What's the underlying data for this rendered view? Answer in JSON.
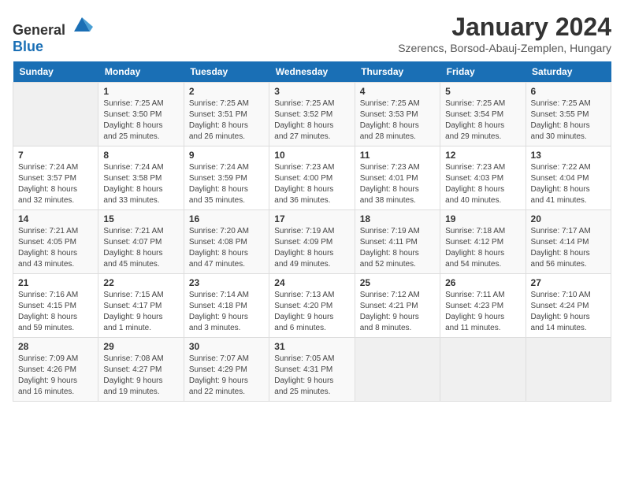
{
  "header": {
    "logo_general": "General",
    "logo_blue": "Blue",
    "month_year": "January 2024",
    "location": "Szerencs, Borsod-Abauj-Zemplen, Hungary"
  },
  "weekdays": [
    "Sunday",
    "Monday",
    "Tuesday",
    "Wednesday",
    "Thursday",
    "Friday",
    "Saturday"
  ],
  "weeks": [
    [
      {
        "day": "",
        "info": ""
      },
      {
        "day": "1",
        "info": "Sunrise: 7:25 AM\nSunset: 3:50 PM\nDaylight: 8 hours\nand 25 minutes."
      },
      {
        "day": "2",
        "info": "Sunrise: 7:25 AM\nSunset: 3:51 PM\nDaylight: 8 hours\nand 26 minutes."
      },
      {
        "day": "3",
        "info": "Sunrise: 7:25 AM\nSunset: 3:52 PM\nDaylight: 8 hours\nand 27 minutes."
      },
      {
        "day": "4",
        "info": "Sunrise: 7:25 AM\nSunset: 3:53 PM\nDaylight: 8 hours\nand 28 minutes."
      },
      {
        "day": "5",
        "info": "Sunrise: 7:25 AM\nSunset: 3:54 PM\nDaylight: 8 hours\nand 29 minutes."
      },
      {
        "day": "6",
        "info": "Sunrise: 7:25 AM\nSunset: 3:55 PM\nDaylight: 8 hours\nand 30 minutes."
      }
    ],
    [
      {
        "day": "7",
        "info": "Sunrise: 7:24 AM\nSunset: 3:57 PM\nDaylight: 8 hours\nand 32 minutes."
      },
      {
        "day": "8",
        "info": "Sunrise: 7:24 AM\nSunset: 3:58 PM\nDaylight: 8 hours\nand 33 minutes."
      },
      {
        "day": "9",
        "info": "Sunrise: 7:24 AM\nSunset: 3:59 PM\nDaylight: 8 hours\nand 35 minutes."
      },
      {
        "day": "10",
        "info": "Sunrise: 7:23 AM\nSunset: 4:00 PM\nDaylight: 8 hours\nand 36 minutes."
      },
      {
        "day": "11",
        "info": "Sunrise: 7:23 AM\nSunset: 4:01 PM\nDaylight: 8 hours\nand 38 minutes."
      },
      {
        "day": "12",
        "info": "Sunrise: 7:23 AM\nSunset: 4:03 PM\nDaylight: 8 hours\nand 40 minutes."
      },
      {
        "day": "13",
        "info": "Sunrise: 7:22 AM\nSunset: 4:04 PM\nDaylight: 8 hours\nand 41 minutes."
      }
    ],
    [
      {
        "day": "14",
        "info": "Sunrise: 7:21 AM\nSunset: 4:05 PM\nDaylight: 8 hours\nand 43 minutes."
      },
      {
        "day": "15",
        "info": "Sunrise: 7:21 AM\nSunset: 4:07 PM\nDaylight: 8 hours\nand 45 minutes."
      },
      {
        "day": "16",
        "info": "Sunrise: 7:20 AM\nSunset: 4:08 PM\nDaylight: 8 hours\nand 47 minutes."
      },
      {
        "day": "17",
        "info": "Sunrise: 7:19 AM\nSunset: 4:09 PM\nDaylight: 8 hours\nand 49 minutes."
      },
      {
        "day": "18",
        "info": "Sunrise: 7:19 AM\nSunset: 4:11 PM\nDaylight: 8 hours\nand 52 minutes."
      },
      {
        "day": "19",
        "info": "Sunrise: 7:18 AM\nSunset: 4:12 PM\nDaylight: 8 hours\nand 54 minutes."
      },
      {
        "day": "20",
        "info": "Sunrise: 7:17 AM\nSunset: 4:14 PM\nDaylight: 8 hours\nand 56 minutes."
      }
    ],
    [
      {
        "day": "21",
        "info": "Sunrise: 7:16 AM\nSunset: 4:15 PM\nDaylight: 8 hours\nand 59 minutes."
      },
      {
        "day": "22",
        "info": "Sunrise: 7:15 AM\nSunset: 4:17 PM\nDaylight: 9 hours\nand 1 minute."
      },
      {
        "day": "23",
        "info": "Sunrise: 7:14 AM\nSunset: 4:18 PM\nDaylight: 9 hours\nand 3 minutes."
      },
      {
        "day": "24",
        "info": "Sunrise: 7:13 AM\nSunset: 4:20 PM\nDaylight: 9 hours\nand 6 minutes."
      },
      {
        "day": "25",
        "info": "Sunrise: 7:12 AM\nSunset: 4:21 PM\nDaylight: 9 hours\nand 8 minutes."
      },
      {
        "day": "26",
        "info": "Sunrise: 7:11 AM\nSunset: 4:23 PM\nDaylight: 9 hours\nand 11 minutes."
      },
      {
        "day": "27",
        "info": "Sunrise: 7:10 AM\nSunset: 4:24 PM\nDaylight: 9 hours\nand 14 minutes."
      }
    ],
    [
      {
        "day": "28",
        "info": "Sunrise: 7:09 AM\nSunset: 4:26 PM\nDaylight: 9 hours\nand 16 minutes."
      },
      {
        "day": "29",
        "info": "Sunrise: 7:08 AM\nSunset: 4:27 PM\nDaylight: 9 hours\nand 19 minutes."
      },
      {
        "day": "30",
        "info": "Sunrise: 7:07 AM\nSunset: 4:29 PM\nDaylight: 9 hours\nand 22 minutes."
      },
      {
        "day": "31",
        "info": "Sunrise: 7:05 AM\nSunset: 4:31 PM\nDaylight: 9 hours\nand 25 minutes."
      },
      {
        "day": "",
        "info": ""
      },
      {
        "day": "",
        "info": ""
      },
      {
        "day": "",
        "info": ""
      }
    ]
  ]
}
